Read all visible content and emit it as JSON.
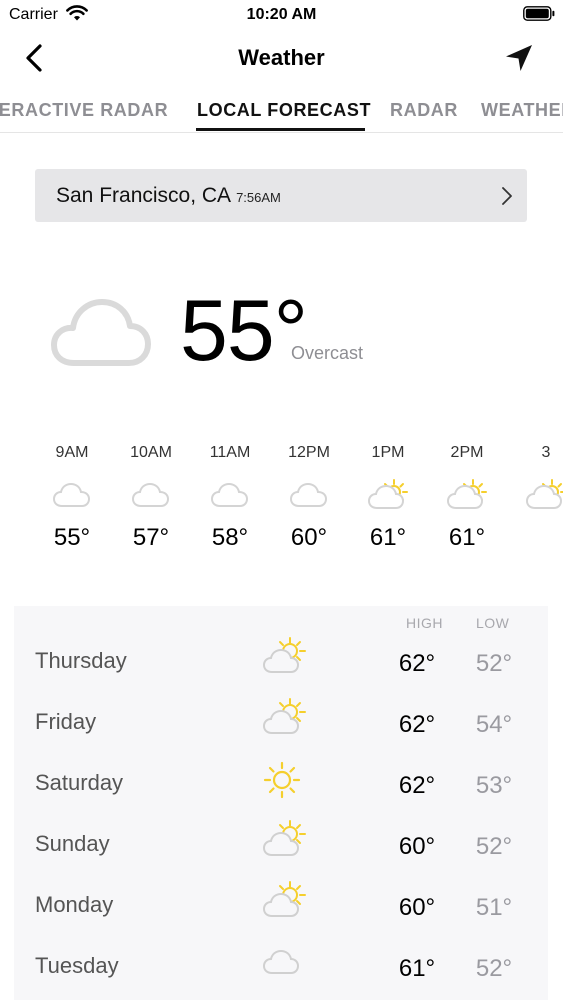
{
  "status_bar": {
    "carrier": "Carrier",
    "time": "10:20 AM"
  },
  "nav": {
    "title": "Weather",
    "back_icon": "chevron-left-icon",
    "locate_icon": "location-arrow-icon"
  },
  "tabs": [
    "INTERACTIVE RADAR",
    "LOCAL FORECAST",
    "RADAR",
    "WEATHER"
  ],
  "active_tab": "LOCAL FORECAST",
  "location": {
    "name": "San Francisco, CA",
    "time": "7:56AM"
  },
  "current": {
    "temp": "55°",
    "condition": "Overcast",
    "icon": "cloud-icon"
  },
  "hourly": [
    {
      "time": "9AM",
      "temp": "55°",
      "icon": "cloud-icon"
    },
    {
      "time": "10AM",
      "temp": "57°",
      "icon": "cloud-icon"
    },
    {
      "time": "11AM",
      "temp": "58°",
      "icon": "cloud-icon"
    },
    {
      "time": "12PM",
      "temp": "60°",
      "icon": "cloud-icon"
    },
    {
      "time": "1PM",
      "temp": "61°",
      "icon": "partly-sunny-icon"
    },
    {
      "time": "2PM",
      "temp": "61°",
      "icon": "partly-sunny-icon"
    },
    {
      "time": "3",
      "temp": "",
      "icon": "partly-sunny-icon"
    }
  ],
  "daily_headers": {
    "high": "HIGH",
    "low": "LOW"
  },
  "daily": [
    {
      "day": "Thursday",
      "high": "62°",
      "low": "52°",
      "icon": "partly-sunny-icon"
    },
    {
      "day": "Friday",
      "high": "62°",
      "low": "54°",
      "icon": "partly-sunny-icon"
    },
    {
      "day": "Saturday",
      "high": "62°",
      "low": "53°",
      "icon": "sun-icon"
    },
    {
      "day": "Sunday",
      "high": "60°",
      "low": "52°",
      "icon": "partly-sunny-icon"
    },
    {
      "day": "Monday",
      "high": "60°",
      "low": "51°",
      "icon": "partly-sunny-icon"
    },
    {
      "day": "Tuesday",
      "high": "61°",
      "low": "52°",
      "icon": "cloud-icon"
    }
  ],
  "colors": {
    "sun": "#f5cf2d",
    "cloud": "#dadada",
    "secondary_text": "#8e8e93"
  }
}
